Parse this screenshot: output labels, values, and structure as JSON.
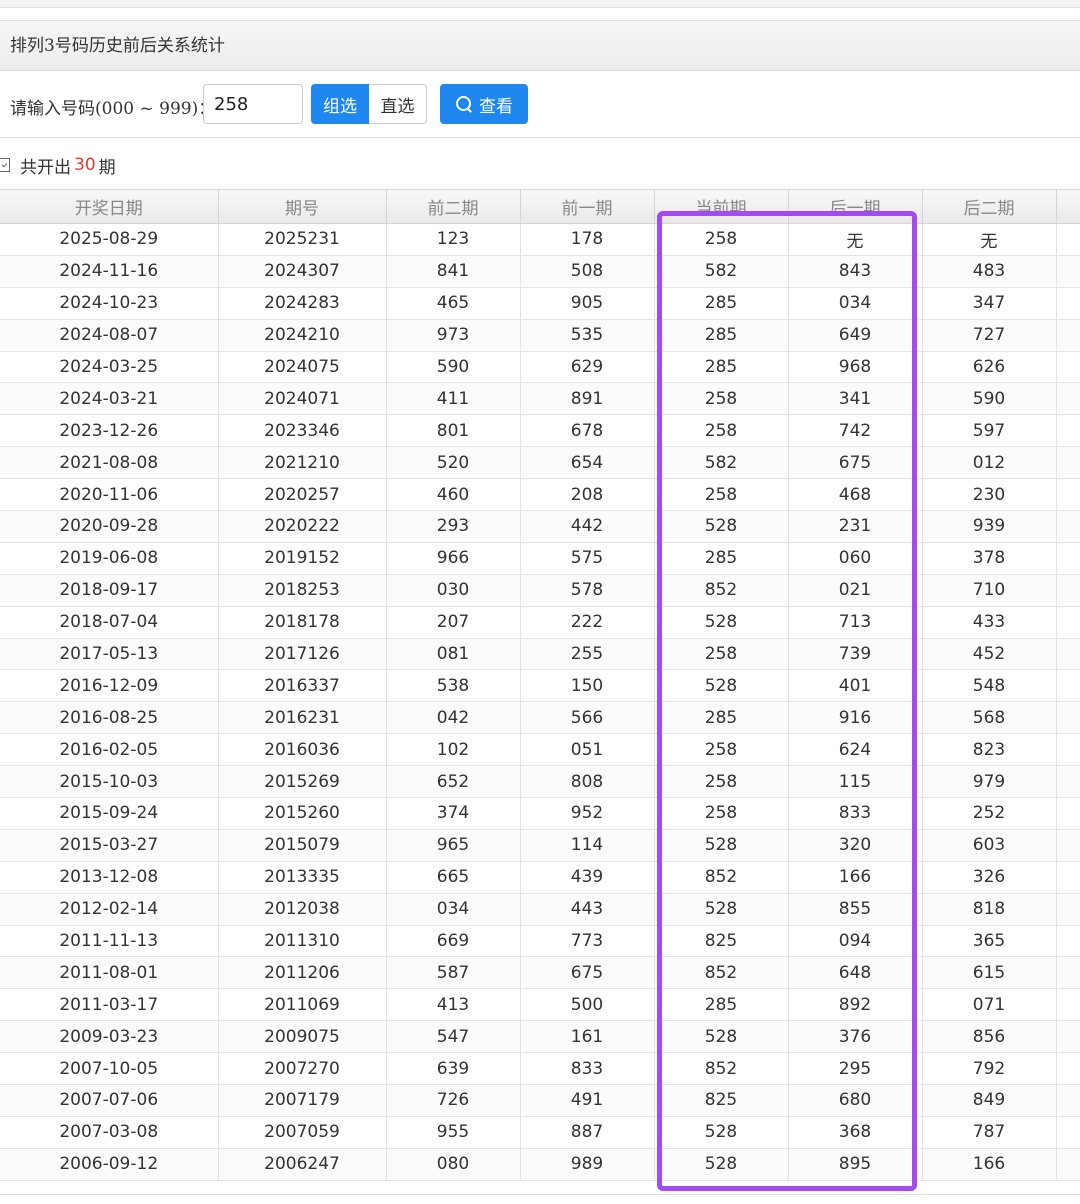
{
  "panel": {
    "title": "排列3号码历史前后关系统计"
  },
  "form": {
    "label": "请输入号码(000 ~ 999)：",
    "input_value": "258",
    "group_select_label": "组选",
    "direct_select_label": "直选",
    "view_label": "查看"
  },
  "summary": {
    "prefix": "共开出",
    "count": "30",
    "suffix": "期"
  },
  "table": {
    "headers": [
      "开奖日期",
      "期号",
      "前二期",
      "前一期",
      "当前期",
      "后一期",
      "后二期",
      ""
    ],
    "rows": [
      [
        "2025-08-29",
        "2025231",
        "123",
        "178",
        "258",
        "无",
        "无"
      ],
      [
        "2024-11-16",
        "2024307",
        "841",
        "508",
        "582",
        "843",
        "483"
      ],
      [
        "2024-10-23",
        "2024283",
        "465",
        "905",
        "285",
        "034",
        "347"
      ],
      [
        "2024-08-07",
        "2024210",
        "973",
        "535",
        "285",
        "649",
        "727"
      ],
      [
        "2024-03-25",
        "2024075",
        "590",
        "629",
        "285",
        "968",
        "626"
      ],
      [
        "2024-03-21",
        "2024071",
        "411",
        "891",
        "258",
        "341",
        "590"
      ],
      [
        "2023-12-26",
        "2023346",
        "801",
        "678",
        "258",
        "742",
        "597"
      ],
      [
        "2021-08-08",
        "2021210",
        "520",
        "654",
        "582",
        "675",
        "012"
      ],
      [
        "2020-11-06",
        "2020257",
        "460",
        "208",
        "258",
        "468",
        "230"
      ],
      [
        "2020-09-28",
        "2020222",
        "293",
        "442",
        "528",
        "231",
        "939"
      ],
      [
        "2019-06-08",
        "2019152",
        "966",
        "575",
        "285",
        "060",
        "378"
      ],
      [
        "2018-09-17",
        "2018253",
        "030",
        "578",
        "852",
        "021",
        "710"
      ],
      [
        "2018-07-04",
        "2018178",
        "207",
        "222",
        "528",
        "713",
        "433"
      ],
      [
        "2017-05-13",
        "2017126",
        "081",
        "255",
        "258",
        "739",
        "452"
      ],
      [
        "2016-12-09",
        "2016337",
        "538",
        "150",
        "528",
        "401",
        "548"
      ],
      [
        "2016-08-25",
        "2016231",
        "042",
        "566",
        "285",
        "916",
        "568"
      ],
      [
        "2016-02-05",
        "2016036",
        "102",
        "051",
        "258",
        "624",
        "823"
      ],
      [
        "2015-10-03",
        "2015269",
        "652",
        "808",
        "258",
        "115",
        "979"
      ],
      [
        "2015-09-24",
        "2015260",
        "374",
        "952",
        "258",
        "833",
        "252"
      ],
      [
        "2015-03-27",
        "2015079",
        "965",
        "114",
        "528",
        "320",
        "603"
      ],
      [
        "2013-12-08",
        "2013335",
        "665",
        "439",
        "852",
        "166",
        "326"
      ],
      [
        "2012-02-14",
        "2012038",
        "034",
        "443",
        "528",
        "855",
        "818"
      ],
      [
        "2011-11-13",
        "2011310",
        "669",
        "773",
        "825",
        "094",
        "365"
      ],
      [
        "2011-08-01",
        "2011206",
        "587",
        "675",
        "852",
        "648",
        "615"
      ],
      [
        "2011-03-17",
        "2011069",
        "413",
        "500",
        "285",
        "892",
        "071"
      ],
      [
        "2009-03-23",
        "2009075",
        "547",
        "161",
        "528",
        "376",
        "856"
      ],
      [
        "2007-10-05",
        "2007270",
        "639",
        "833",
        "852",
        "295",
        "792"
      ],
      [
        "2007-07-06",
        "2007179",
        "726",
        "491",
        "825",
        "680",
        "849"
      ],
      [
        "2007-03-08",
        "2007059",
        "955",
        "887",
        "528",
        "368",
        "787"
      ],
      [
        "2006-09-12",
        "2006247",
        "080",
        "989",
        "528",
        "895",
        "166"
      ]
    ]
  },
  "colors": {
    "primary": "#1e88f0",
    "count": "#e03c31",
    "highlight": "#a24bf0"
  }
}
